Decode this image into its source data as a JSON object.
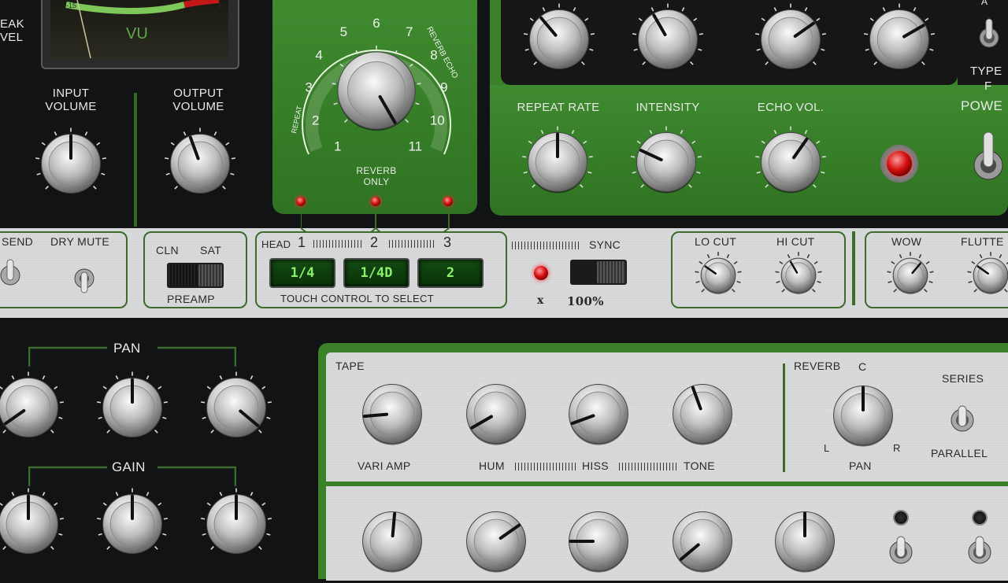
{
  "vu": {
    "label": "VU",
    "scale_left": "-15",
    "scale_right": "3"
  },
  "left_top": {
    "peak_level_line1": "EAK",
    "peak_level_line2": "VEL"
  },
  "volume": {
    "input_label": "INPUT\nVOLUME",
    "output_label": "OUTPUT\nVOLUME"
  },
  "reverb_dial": {
    "numbers": [
      "1",
      "2",
      "3",
      "4",
      "5",
      "6",
      "7",
      "8",
      "9",
      "10",
      "11"
    ],
    "repeat_label": "REPEAT",
    "reverb_echo_label": "REVERB ECHO",
    "reverb_only_label": "REVERB\nONLY"
  },
  "echo": {
    "repeat_rate": "REPEAT RATE",
    "intensity": "INTENSITY",
    "echo_vol": "ECHO VOL.",
    "type_label": "TYPE",
    "type_value": "F",
    "type_top": "A",
    "power": "POWE"
  },
  "strip": {
    "send": "SEND",
    "dry_mute": "DRY MUTE",
    "preamp": {
      "cln": "CLN",
      "sat": "SAT",
      "label": "PREAMP"
    },
    "heads": {
      "head": "HEAD",
      "h1": "1",
      "h2": "2",
      "h3": "3"
    },
    "selectors": [
      "1/4",
      "1/4D",
      "2"
    ],
    "touch_label": "TOUCH CONTROL TO SELECT",
    "sync": {
      "label": "SYNC",
      "x": "x",
      "percent": "100%"
    },
    "lo_cut": "LO CUT",
    "hi_cut": "HI CUT",
    "wow": "WOW",
    "flutter": "FLUTTE"
  },
  "mixer": {
    "pan": "PAN",
    "gain": "GAIN"
  },
  "tape": {
    "title": "TAPE",
    "vari_amp": "VARI AMP",
    "hum": "HUM",
    "hiss": "HISS",
    "tone": "TONE",
    "reverb": "REVERB",
    "pan": "PAN",
    "pan_c": "C",
    "pan_l": "L",
    "pan_r": "R",
    "series": "SERIES",
    "parallel": "PARALLEL"
  },
  "colors": {
    "panel_green": "#3a8129",
    "led_red": "#e01010",
    "lcd_green": "#8cf06a",
    "background": "#121314"
  }
}
